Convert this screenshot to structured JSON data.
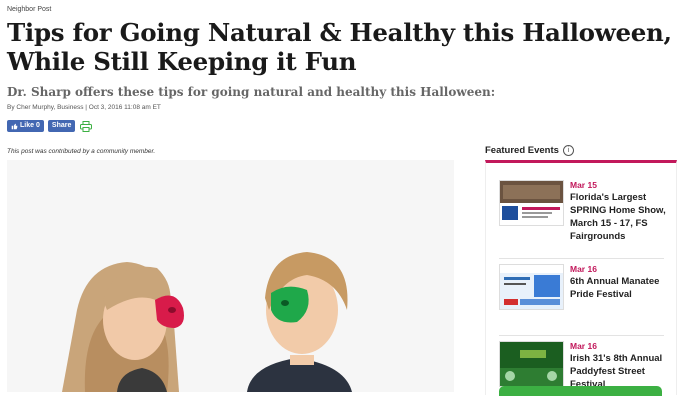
{
  "article": {
    "kicker": "Neighbor Post",
    "headline": "Tips for Going Natural & Healthy this Halloween, While Still Keeping it Fun",
    "subhead": "Dr. Sharp offers these tips for going natural and healthy this Halloween:",
    "byline": "By Cher Murphy, Business | Oct 3, 2016 11:08 am ET",
    "contributed": "This post was contributed by a community member."
  },
  "share": {
    "like_label": "Like",
    "like_count": "0",
    "share_label": "Share",
    "icons": [
      "thumbs-up-icon",
      "printer-icon"
    ]
  },
  "sidebar": {
    "title": "Featured Events",
    "events": [
      {
        "date": "Mar 15",
        "title": "Florida's Largest SPRING Home Show, March 15 - 17, FS Fairgrounds"
      },
      {
        "date": "Mar 16",
        "title": "6th Annual Manatee Pride Festival"
      },
      {
        "date": "Mar 16",
        "title": "Irish 31's 8th Annual Paddyfest Street Festival"
      }
    ]
  },
  "colors": {
    "accent": "#c2185b",
    "facebook": "#4267b2",
    "print_green": "#3cb043"
  }
}
